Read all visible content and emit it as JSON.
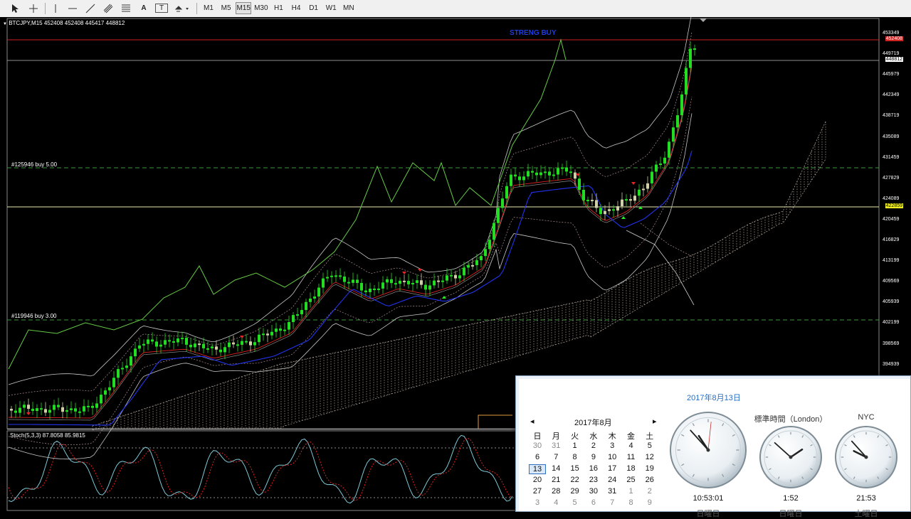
{
  "toolbar": {
    "tools": [
      "cursor-icon",
      "crosshair-icon",
      "vertical-line-icon",
      "horizontal-line-icon",
      "trend-line-icon",
      "channel-icon",
      "fibonacci-icon",
      "text-icon",
      "text-label-icon",
      "arrows-icon"
    ],
    "text_tool_label": "A",
    "label_tool_label": "T",
    "timeframes": [
      "M1",
      "M5",
      "M15",
      "M30",
      "H1",
      "H4",
      "D1",
      "W1",
      "MN"
    ],
    "active_timeframe": "M15"
  },
  "chart": {
    "header": "BTCJPY,M15  452408 452408 445417 448812",
    "strong_buy": "STRENG BUY",
    "order1": "#125946 buy 5.00",
    "order2": "#119946 buy 3.00",
    "price_labels": [
      "453349",
      "449719",
      "445979",
      "442349",
      "438719",
      "435089",
      "431459",
      "427829",
      "424089",
      "420459",
      "416829",
      "413199",
      "409569",
      "405939",
      "402199",
      "398569",
      "394939"
    ],
    "tag_red": "452408",
    "tag_white": "448812",
    "tag_yellow": "422859",
    "colors": {
      "bull": "#22dd22",
      "bear": "#cfcfa8",
      "stoch_main": "#7ec8d8",
      "stoch_signal": "#dd2222",
      "green_line": "#66cc44"
    }
  },
  "stoch": {
    "label": "Stoch(5,3,3) 87.8058 85.9815"
  },
  "calendar": {
    "title": "2017年8月13日",
    "month": "2017年8月",
    "prev": "◂",
    "next": "▸",
    "weekdays": [
      "日",
      "月",
      "火",
      "水",
      "木",
      "金",
      "土"
    ],
    "weeks": [
      [
        "30",
        "31",
        "1",
        "2",
        "3",
        "4",
        "5"
      ],
      [
        "6",
        "7",
        "8",
        "9",
        "10",
        "11",
        "12"
      ],
      [
        "13",
        "14",
        "15",
        "16",
        "17",
        "18",
        "19"
      ],
      [
        "20",
        "21",
        "22",
        "23",
        "24",
        "25",
        "26"
      ],
      [
        "27",
        "28",
        "29",
        "30",
        "31",
        "1",
        "2"
      ],
      [
        "3",
        "4",
        "5",
        "6",
        "7",
        "8",
        "9"
      ]
    ],
    "today": "13",
    "clocks": [
      {
        "label": "",
        "time": "10:53:01",
        "day": "日曜日",
        "hour": 10,
        "minute": 53,
        "second": 1
      },
      {
        "label": "標準時間（London）",
        "time": "1:52",
        "day": "日曜日",
        "hour": 1,
        "minute": 52,
        "second": 0
      },
      {
        "label": "NYC",
        "time": "21:53",
        "day": "土曜日",
        "hour": 21,
        "minute": 53,
        "second": 0
      }
    ]
  }
}
